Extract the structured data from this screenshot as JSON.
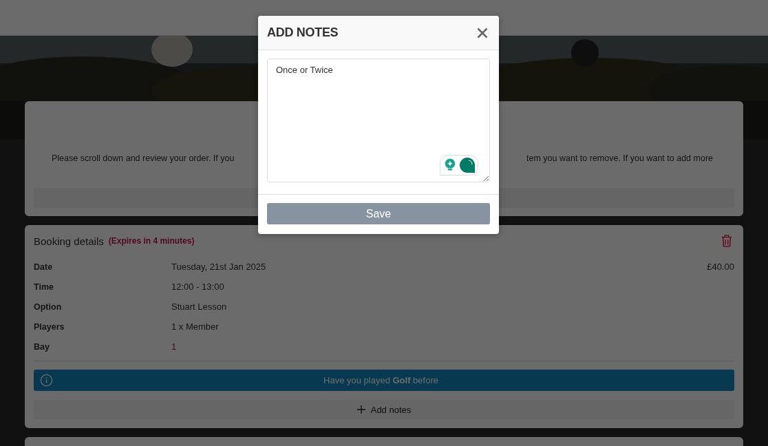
{
  "order_card": {
    "message_left": "Please scroll down and review your order. If you",
    "message_right": "tem you want to remove. If you want to add more"
  },
  "booking": {
    "title": "Booking details",
    "expiry": "(Expires in 4 minutes)",
    "price": "£40.00",
    "details": [
      {
        "label": "Date",
        "value": "Tuesday, 21st Jan 2025",
        "highlight": false
      },
      {
        "label": "Time",
        "value": "12:00 - 13:00",
        "highlight": false
      },
      {
        "label": "Option",
        "value": "Stuart Lesson",
        "highlight": false
      },
      {
        "label": "Players",
        "value": "1 x Member",
        "highlight": false
      },
      {
        "label": "Bay",
        "value": "1",
        "highlight": true
      }
    ],
    "question": "Have you played **Golf** before",
    "add_notes": "Add notes"
  },
  "modal": {
    "title": "ADD NOTES",
    "notes_value": "Once or Twice",
    "save": "Save"
  }
}
